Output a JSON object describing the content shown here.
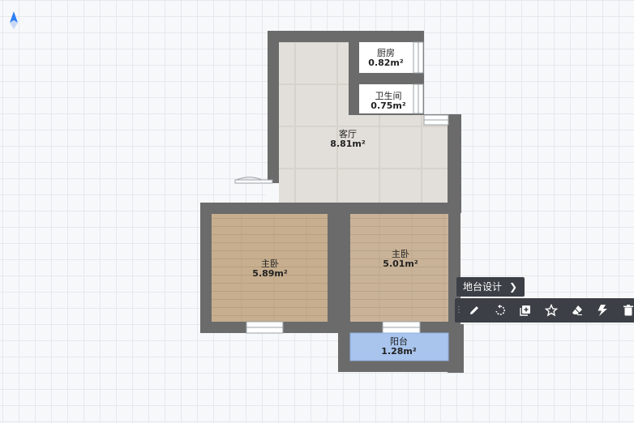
{
  "floorplan": {
    "rooms": [
      {
        "name": "厨房",
        "area": "0.82m²"
      },
      {
        "name": "卫生间",
        "area": "0.75m²"
      },
      {
        "name": "客厅",
        "area": "8.81m²"
      },
      {
        "name": "主卧",
        "area": "5.89m²"
      },
      {
        "name": "主卧",
        "area": "5.01m²"
      },
      {
        "name": "阳台",
        "area": "1.28m²"
      }
    ]
  },
  "popup": {
    "title": "地台设计",
    "tools": [
      "edit-icon",
      "rotate-icon",
      "copy-icon",
      "favorite-icon",
      "eraser-icon",
      "flash-icon",
      "delete-icon"
    ]
  },
  "colors": {
    "wall": "#6b6b6b",
    "living_floor": "#e2dfda",
    "wood_floor": "#c8b193",
    "balcony_floor": "#a9c5ee",
    "toolbar_bg": "#3c4046"
  }
}
